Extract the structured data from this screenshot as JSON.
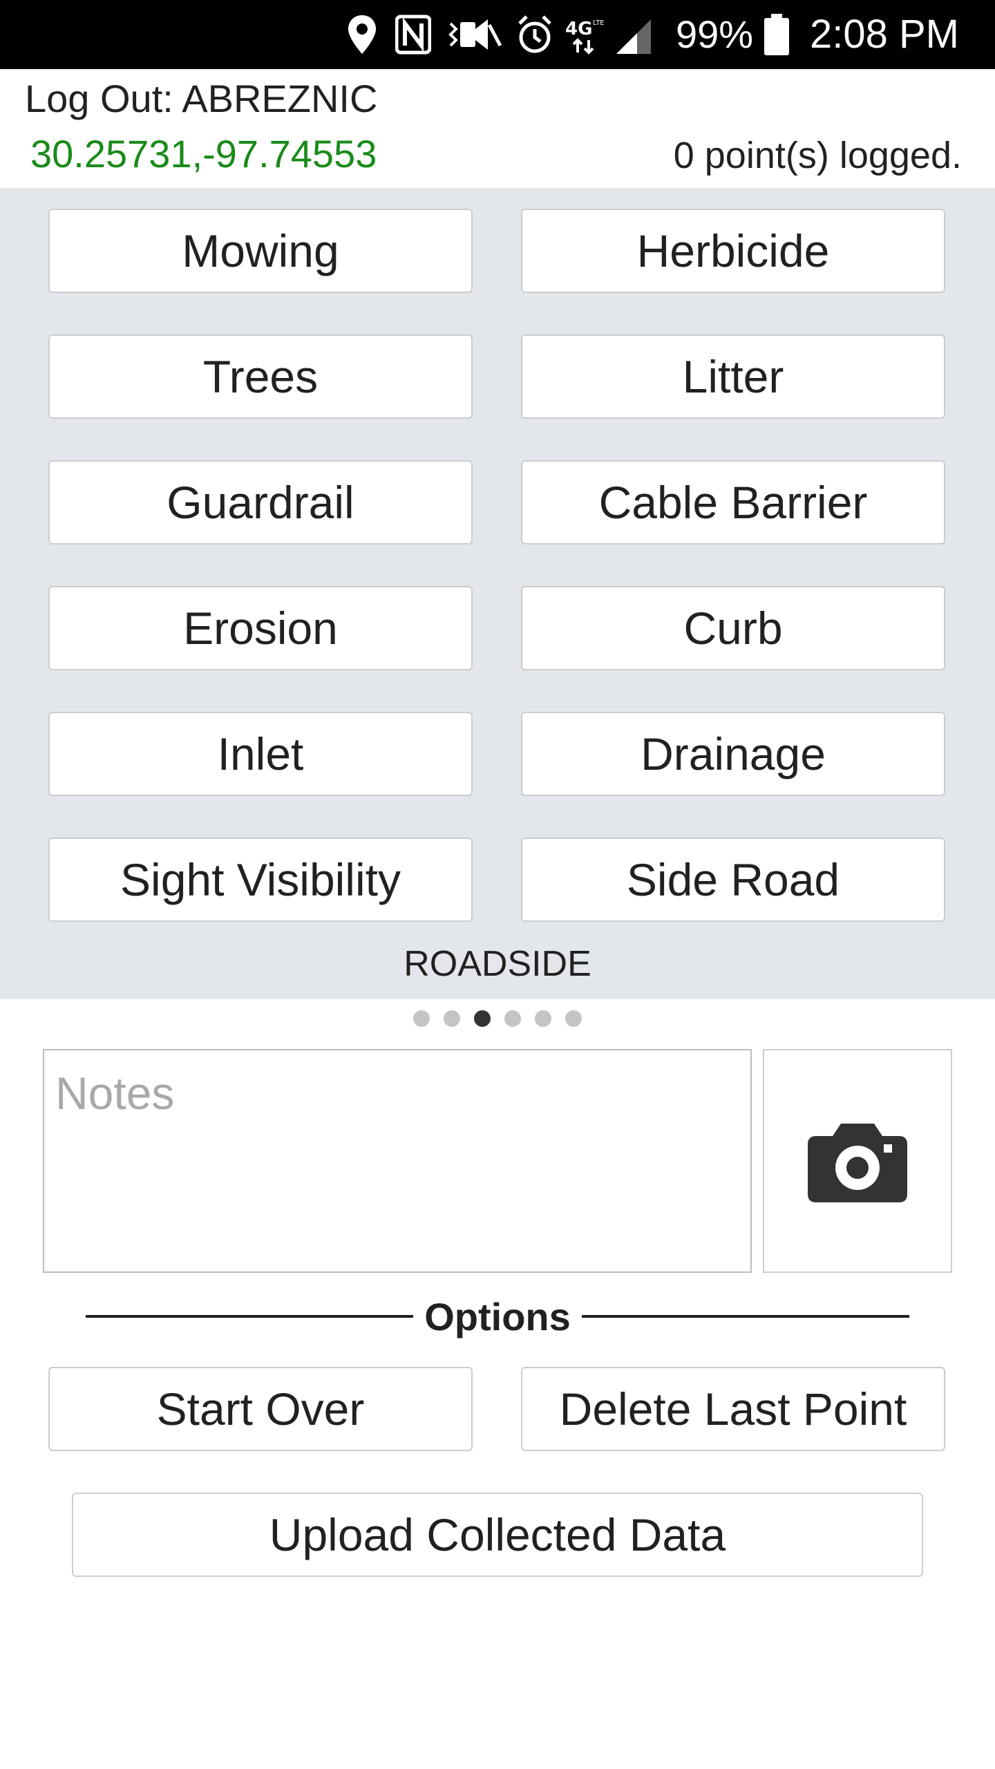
{
  "status_bar": {
    "icons": [
      "location-icon",
      "nfc-icon",
      "vibrate-icon",
      "alarm-icon",
      "4g-lte-icon",
      "signal-icon",
      "battery-icon"
    ],
    "battery_percent": "99%",
    "time": "2:08 PM"
  },
  "header": {
    "logout_label": "Log Out: ABREZNIC",
    "coordinates": "30.25731,-97.74553",
    "points_logged": "0 point(s) logged.",
    "coordinate_color": "#1a8a1a"
  },
  "categories": {
    "items": [
      {
        "label": "Mowing"
      },
      {
        "label": "Herbicide"
      },
      {
        "label": "Trees"
      },
      {
        "label": "Litter"
      },
      {
        "label": "Guardrail"
      },
      {
        "label": "Cable Barrier"
      },
      {
        "label": "Erosion"
      },
      {
        "label": "Curb"
      },
      {
        "label": "Inlet"
      },
      {
        "label": "Drainage"
      },
      {
        "label": "Sight Visibility"
      },
      {
        "label": "Side Road"
      }
    ],
    "group_label": "ROADSIDE",
    "panel_color": "#e3e7ec"
  },
  "pager": {
    "page_count": 6,
    "active_index": 2
  },
  "notes": {
    "placeholder": "Notes",
    "value": ""
  },
  "camera": {
    "icon": "camera-icon"
  },
  "options": {
    "label": "Options",
    "start_over": "Start Over",
    "delete_last_point": "Delete Last Point",
    "upload": "Upload Collected Data"
  }
}
